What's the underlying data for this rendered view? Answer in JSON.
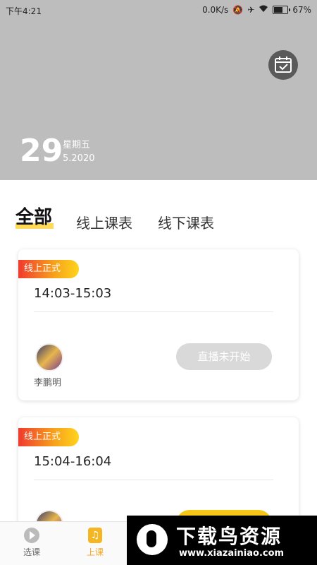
{
  "status": {
    "time": "下午4:21",
    "network_speed": "0.0K/s",
    "battery_percent": "67%",
    "battery_level": 0.67
  },
  "header": {
    "day": "29",
    "weekday": "星期五",
    "month_year": "5.2020",
    "calendar_icon": "calendar-check-icon"
  },
  "tabs": [
    {
      "label": "全部",
      "active": true
    },
    {
      "label": "线上课表",
      "active": false
    },
    {
      "label": "线下课表",
      "active": false
    }
  ],
  "courses": [
    {
      "tag": "线上正式",
      "time": "14:03-15:03",
      "teacher": "李鹏明",
      "status": "直播未开始"
    },
    {
      "tag": "线上正式",
      "time": "15:04-16:04",
      "teacher": "",
      "status": ""
    }
  ],
  "bottom_nav": [
    {
      "label": "选课",
      "icon": "play-icon",
      "active": false
    },
    {
      "label": "上课",
      "icon": "note-icon",
      "active": true
    }
  ],
  "watermark": {
    "title": "下载鸟资源",
    "url": "www.xiazainiao.com"
  },
  "colors": {
    "header_bg": "#bdbdbd",
    "accent": "#f5a623",
    "tag_start": "#f03a2e",
    "tag_end": "#ffd41c",
    "disabled_button": "#d9d9d9"
  }
}
